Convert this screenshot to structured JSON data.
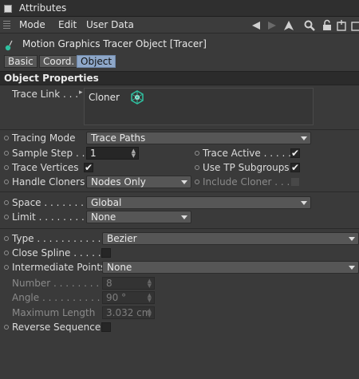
{
  "window": {
    "title": "Attributes"
  },
  "menu": {
    "items": [
      "Mode",
      "Edit",
      "User Data"
    ]
  },
  "object": {
    "title": "Motion Graphics Tracer Object [Tracer]"
  },
  "tabs": [
    {
      "label": "Basic",
      "active": false
    },
    {
      "label": "Coord.",
      "active": false
    },
    {
      "label": "Object",
      "active": true
    }
  ],
  "section": {
    "title": "Object Properties"
  },
  "trace_link": {
    "label": "Trace Link",
    "value": "Cloner"
  },
  "fields": {
    "tracing_mode": {
      "label": "Tracing Mode",
      "value": "Trace Paths"
    },
    "sample_step": {
      "label": "Sample Step",
      "value": "1"
    },
    "trace_active": {
      "label": "Trace Active",
      "checked": true
    },
    "trace_vertices": {
      "label": "Trace Vertices",
      "checked": true
    },
    "use_tp_subgroups": {
      "label": "Use TP Subgroups",
      "checked": true
    },
    "handle_cloners": {
      "label": "Handle Cloners",
      "value": "Nodes Only"
    },
    "include_cloner": {
      "label": "Include Cloner",
      "checked": false
    },
    "space": {
      "label": "Space",
      "value": "Global"
    },
    "limit": {
      "label": "Limit",
      "value": "None"
    },
    "type": {
      "label": "Type",
      "value": "Bezier"
    },
    "close_spline": {
      "label": "Close Spline",
      "checked": false
    },
    "intermediate_points": {
      "label": "Intermediate Points",
      "value": "None"
    },
    "number": {
      "label": "Number",
      "value": "8"
    },
    "angle": {
      "label": "Angle",
      "value": "90 °"
    },
    "maximum_length": {
      "label": "Maximum Length",
      "value": "3.032 cm"
    },
    "reverse_sequence": {
      "label": "Reverse Sequence",
      "checked": false
    }
  },
  "colors": {
    "background": "#3a3a3a",
    "active_tab": "#8ea7c8",
    "section_header": "#2b2b2b",
    "cloner_icon": "#2fc0a0"
  }
}
